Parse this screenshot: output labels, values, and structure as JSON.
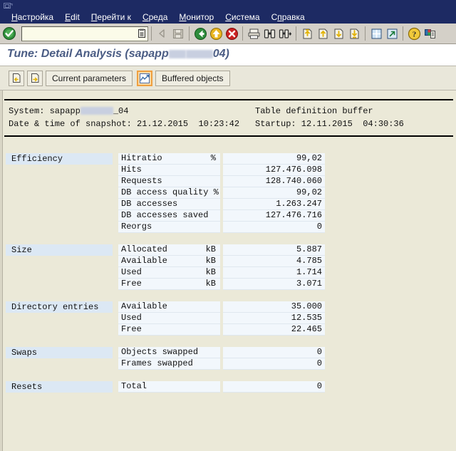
{
  "window": {
    "icon": "window-restore-icon"
  },
  "menubar": {
    "items": [
      {
        "label": "Настройка",
        "accel": "Н"
      },
      {
        "label": "Edit",
        "accel": "E"
      },
      {
        "label": "Перейти к",
        "accel": "П"
      },
      {
        "label": "Среда",
        "accel": "С"
      },
      {
        "label": "Монитор",
        "accel": "М"
      },
      {
        "label": "Система",
        "accel": "С"
      },
      {
        "label": "Справка",
        "accel": "п"
      }
    ]
  },
  "toolbar": {
    "enter_icon": "green-check-enter-icon",
    "command_field": {
      "value": "",
      "placeholder": "",
      "list_icon": "command-history-icon"
    },
    "buttons": [
      {
        "name": "back-arrow-icon",
        "group": 0
      },
      {
        "name": "save-disk-icon",
        "group": 0
      },
      {
        "name": "back-green-icon",
        "group": 1
      },
      {
        "name": "exit-yellow-icon",
        "group": 1
      },
      {
        "name": "cancel-red-icon",
        "group": 1
      },
      {
        "name": "print-icon",
        "group": 2
      },
      {
        "name": "find-binoculars-icon",
        "group": 2
      },
      {
        "name": "find-next-binoculars-icon",
        "group": 2
      },
      {
        "name": "first-page-icon",
        "group": 3
      },
      {
        "name": "previous-page-icon",
        "group": 3
      },
      {
        "name": "next-page-icon",
        "group": 3
      },
      {
        "name": "last-page-icon",
        "group": 3
      },
      {
        "name": "new-session-icon",
        "group": 4
      },
      {
        "name": "create-shortcut-icon",
        "group": 4
      },
      {
        "name": "help-question-icon",
        "group": 5
      },
      {
        "name": "layout-menu-icon",
        "group": 5
      }
    ]
  },
  "page": {
    "title_prefix": "Tune: Detail Analysis (sapapp",
    "title_suffix": "04)",
    "title_redacted": true
  },
  "appbar": {
    "buttons": [
      {
        "name": "previous-buffer-icon",
        "type": "icon",
        "label": ""
      },
      {
        "name": "next-buffer-icon",
        "type": "icon",
        "label": ""
      },
      {
        "name": "current-parameters-button",
        "type": "text",
        "label": "Current parameters"
      },
      {
        "name": "buffered-objects-icon",
        "type": "icon-selected",
        "label": ""
      },
      {
        "name": "buffered-objects-button",
        "type": "text",
        "label": "Buffered objects"
      }
    ]
  },
  "header": {
    "system_label": "System: sapapp",
    "system_suffix": "_04",
    "snapshot_label": "Date & time of snapshot: 21.12.2015  10:23:42",
    "buffer_name": "Table definition buffer",
    "startup_label": "Startup: 12.11.2015  04:30:36"
  },
  "table": {
    "sections": [
      {
        "name": "Efficiency",
        "rows": [
          {
            "label": "Hitratio",
            "unit": "%",
            "value": "99,02"
          },
          {
            "label": "Hits",
            "unit": "",
            "value": "127.476.098"
          },
          {
            "label": "Requests",
            "unit": "",
            "value": "128.740.060"
          },
          {
            "label": "DB access quality %",
            "unit": "",
            "value": "99,02"
          },
          {
            "label": "DB accesses",
            "unit": "",
            "value": "1.263.247"
          },
          {
            "label": "DB accesses saved",
            "unit": "",
            "value": "127.476.716"
          },
          {
            "label": "Reorgs",
            "unit": "",
            "value": "0"
          }
        ]
      },
      {
        "name": "Size",
        "rows": [
          {
            "label": "Allocated",
            "unit": "kB",
            "value": "5.887"
          },
          {
            "label": "Available",
            "unit": "kB",
            "value": "4.785"
          },
          {
            "label": "Used",
            "unit": "kB",
            "value": "1.714"
          },
          {
            "label": "Free",
            "unit": "kB",
            "value": "3.071"
          }
        ]
      },
      {
        "name": "Directory entries",
        "rows": [
          {
            "label": "Available",
            "unit": "",
            "value": "35.000"
          },
          {
            "label": "Used",
            "unit": "",
            "value": "12.535"
          },
          {
            "label": "Free",
            "unit": "",
            "value": "22.465"
          }
        ]
      },
      {
        "name": "Swaps",
        "rows": [
          {
            "label": "Objects swapped",
            "unit": "",
            "value": "0"
          },
          {
            "label": "Frames swapped",
            "unit": "",
            "value": "0"
          }
        ]
      },
      {
        "name": "Resets",
        "rows": [
          {
            "label": "Total",
            "unit": "",
            "value": "0"
          }
        ]
      }
    ]
  },
  "colors": {
    "menubar_bg": "#1d2a63",
    "toolbar_bg": "#d4d0c8",
    "canvas_bg": "#ebe9d8",
    "title_fg": "#4a5c84",
    "row_bg": "#f2f7fc",
    "section_bg": "#dce8f4",
    "selected_border": "#f0a040"
  }
}
